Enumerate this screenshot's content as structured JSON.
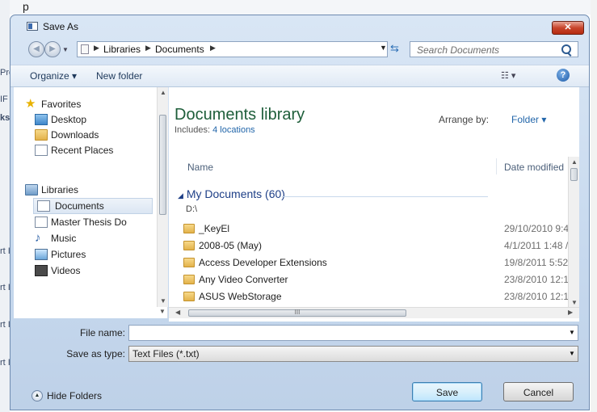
{
  "background": {
    "top_text": "p",
    "side_fragments": [
      "Pre",
      "IF",
      "ks",
      "rt I",
      "rt I",
      "rt I",
      "rt I"
    ]
  },
  "dialog": {
    "title": "Save As",
    "close_glyph": "✕",
    "address": {
      "crumbs": [
        "Libraries",
        "Documents"
      ]
    },
    "search": {
      "placeholder": "Search Documents"
    },
    "toolbar": {
      "organize": "Organize ▾",
      "new_folder": "New folder",
      "views": "☷ ▾",
      "help": "?"
    },
    "nav_pane": {
      "items": [
        {
          "label": "Favorites",
          "icon": "star-icon"
        },
        {
          "label": "Desktop",
          "icon": "desktop-icon"
        },
        {
          "label": "Downloads",
          "icon": "downloads-folder-icon"
        },
        {
          "label": "Recent Places",
          "icon": "recent-places-icon"
        },
        {
          "label": "Libraries",
          "icon": "libraries-icon"
        },
        {
          "label": "Documents",
          "icon": "documents-icon",
          "selected": true
        },
        {
          "label": "Master Thesis Do",
          "icon": "library-icon"
        },
        {
          "label": "Music",
          "icon": "music-icon"
        },
        {
          "label": "Pictures",
          "icon": "pictures-icon"
        },
        {
          "label": "Videos",
          "icon": "videos-icon"
        }
      ]
    },
    "library": {
      "title": "Documents library",
      "includes_label": "Includes:",
      "includes_link": "4 locations",
      "arrange_label": "Arrange by:",
      "arrange_value": "Folder ▾"
    },
    "columns": {
      "name": "Name",
      "date_modified": "Date modified"
    },
    "group": {
      "header": "My Documents (60)",
      "path": "D:\\"
    },
    "files": [
      {
        "name": "_KeyEl",
        "date": "29/10/2010 9:4"
      },
      {
        "name": "2008-05 (May)",
        "date": "4/1/2011 1:48 /"
      },
      {
        "name": "Access Developer Extensions",
        "date": "19/8/2011 5:52"
      },
      {
        "name": "Any Video Converter",
        "date": "23/8/2010 12:1"
      },
      {
        "name": "ASUS WebStorage",
        "date": "23/8/2010 12:1"
      }
    ],
    "hscroll_grip": "III",
    "file_name": {
      "label": "File name:",
      "value": ""
    },
    "save_as_type": {
      "label": "Save as type:",
      "value": "Text Files (*.txt)"
    },
    "hide_folders": "Hide Folders",
    "buttons": {
      "save": "Save",
      "cancel": "Cancel"
    }
  }
}
